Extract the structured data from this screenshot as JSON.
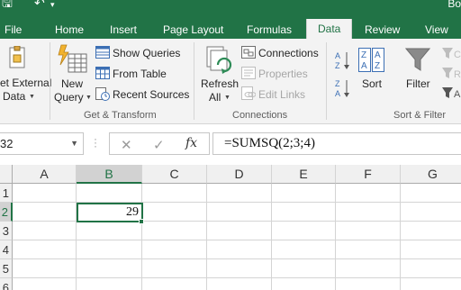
{
  "qat": {
    "save_glyph": "🖫",
    "undo_glyph": "↶",
    "undo_caret": "▾"
  },
  "account_name": "Bo",
  "tabs": [
    {
      "label": "File"
    },
    {
      "label": "Home"
    },
    {
      "label": "Insert"
    },
    {
      "label": "Page Layout"
    },
    {
      "label": "Formulas"
    },
    {
      "label": "Data"
    },
    {
      "label": "Review"
    },
    {
      "label": "View"
    }
  ],
  "active_tab": "Data",
  "ribbon": {
    "get_external_data": {
      "line1": "et External",
      "line2": "Data"
    },
    "new_query": {
      "line1": "New",
      "line2": "Query"
    },
    "show_queries": "Show Queries",
    "from_table": "From Table",
    "recent_sources": "Recent Sources",
    "group_get_transform": "Get & Transform",
    "refresh_all": {
      "line1": "Refresh",
      "line2": "All"
    },
    "connections": "Connections",
    "properties": "Properties",
    "edit_links": "Edit Links",
    "group_connections": "Connections",
    "sort": "Sort",
    "filter": "Filter",
    "group_sort_filter": "Sort & Filter"
  },
  "formula_bar": {
    "name_box": "32",
    "cancel_glyph": "✕",
    "enter_glyph": "✓",
    "fx_label": "fx",
    "formula": "=SUMSQ(2;3;4)"
  },
  "grid": {
    "columns": [
      "A",
      "B",
      "C",
      "D",
      "E",
      "F",
      "G"
    ],
    "selected_column": "B",
    "rows": [
      "1",
      "2",
      "3",
      "4",
      "5",
      "6"
    ],
    "selected_row": "2",
    "active_cell": {
      "ref": "B2",
      "value": "29"
    }
  },
  "colors": {
    "excel_green": "#217346",
    "ribbon_bg": "#f3f3f3",
    "header_bg": "#f0f0f0",
    "selected_header_bg": "#d2d2d2",
    "gridline": "#d4d4d4"
  }
}
